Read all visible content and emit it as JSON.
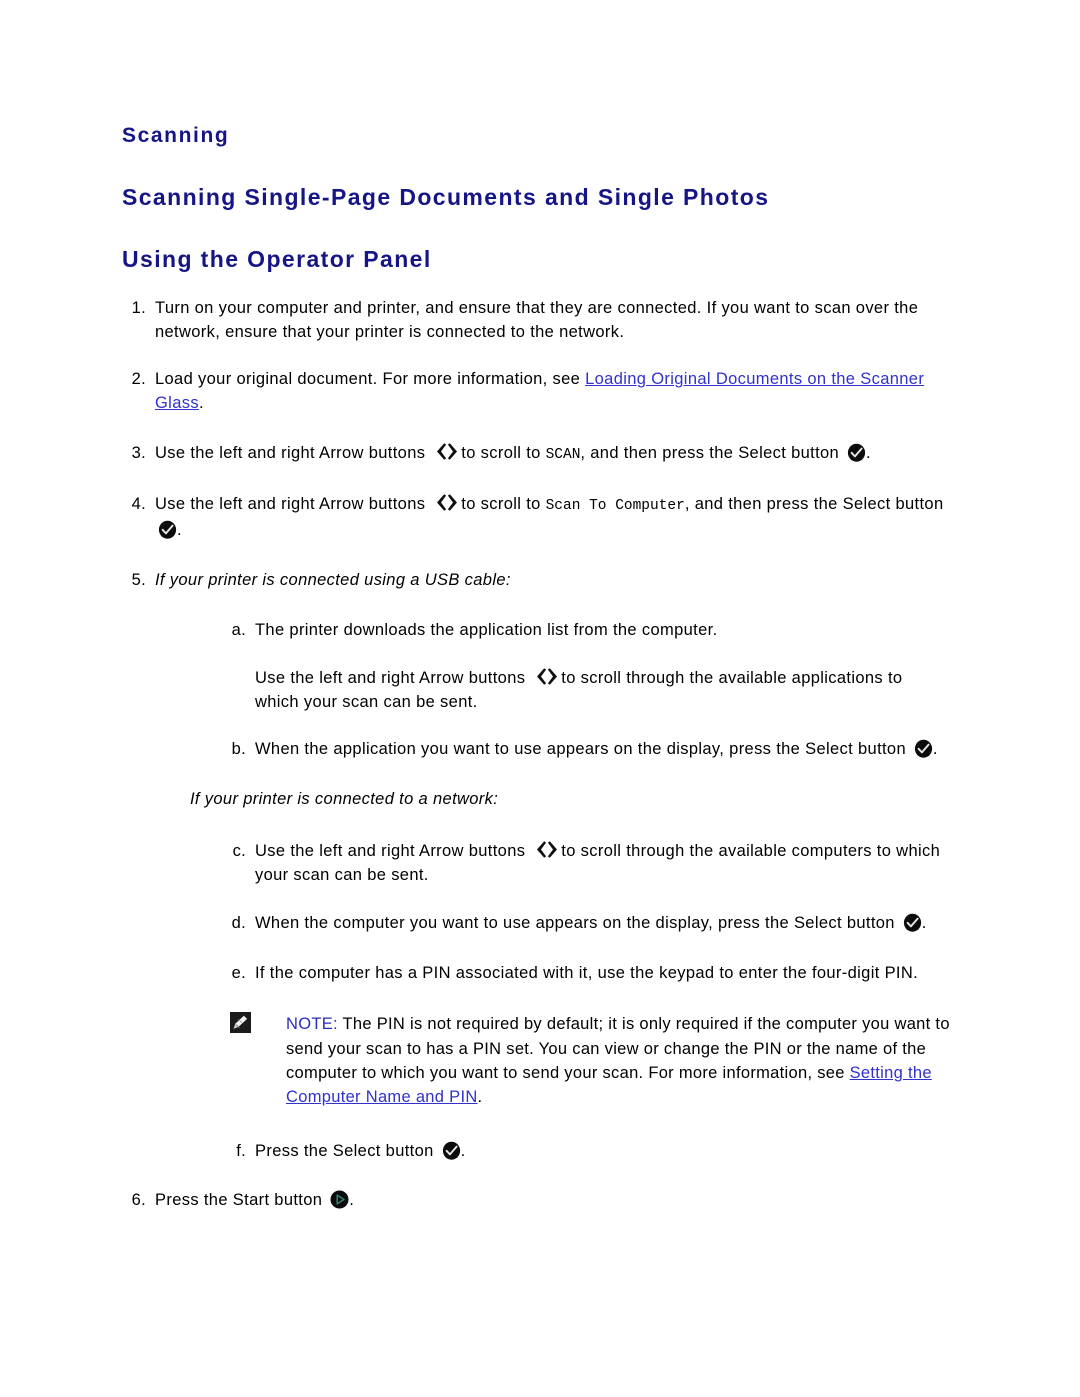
{
  "document": {
    "heading_main": "Scanning",
    "heading_sub": "Scanning Single-Page Documents and Single Photos",
    "heading_sub2": "Using the Operator Panel"
  },
  "colors": {
    "heading": "#151585",
    "link": "#3131cc",
    "note_label": "#2b2bbb",
    "body_text": "#000000",
    "page_background": "#ffffff",
    "start_icon_accent": "#2e7d6e"
  },
  "icons": {
    "arrows": "left-right-arrow-buttons-icon",
    "select": "select-button-check-icon",
    "start": "start-button-play-icon",
    "note": "note-pencil-icon"
  },
  "steps": {
    "s1": {
      "num": "1.",
      "text": "Turn on your computer and printer, and ensure that they are connected. If you want to scan over the network, ensure that your printer is connected to the network."
    },
    "s2": {
      "num": "2.",
      "text_before": "Load your original document. For more information, see ",
      "link": "Loading Original Documents on the Scanner Glass",
      "text_after": "."
    },
    "s3": {
      "num": "3.",
      "t1": "Use the left and right Arrow buttons ",
      "t2": "to scroll to ",
      "mono": "SCAN",
      "t3": ", and then press the Select button ",
      "t4": "."
    },
    "s4": {
      "num": "4.",
      "t1": "Use the left and right Arrow buttons ",
      "t2": "to scroll to ",
      "mono": "Scan To Computer",
      "t3": ", and then press the Select button ",
      "t4": "."
    },
    "s5": {
      "num": "5.",
      "text": "If your printer is connected using a USB cable:"
    },
    "s5a": {
      "num": "a.",
      "text": "The printer downloads the application list from the computer."
    },
    "s5a_cont": {
      "t1": "Use the left and right Arrow buttons ",
      "t2": "to scroll through the available applications to which your scan can be sent."
    },
    "s5b": {
      "num": "b.",
      "t1": "When the application you want to use appears on the display, press the Select button ",
      "t2": "."
    },
    "network_intro": {
      "text": "If your printer is connected to a network:"
    },
    "s5c": {
      "num": "c.",
      "t1": "Use the left and right Arrow buttons ",
      "t2": "to scroll through the available computers to which your scan can be sent."
    },
    "s5d": {
      "num": "d.",
      "t1": "When the computer you want to use appears on the display, press the Select button ",
      "t2": "."
    },
    "s5e": {
      "num": "e.",
      "text": "If the computer has a PIN associated with it, use the keypad to enter the four-digit PIN."
    },
    "note": {
      "label": "NOTE:",
      "text_before": " The PIN is not required by default; it is only required if the computer you want to send your scan to has a PIN set. You can view or change the PIN or the name of the computer to which you want to send your scan. For more information, see ",
      "link": "Setting the Computer Name and PIN",
      "text_after": "."
    },
    "s5f": {
      "num": "f.",
      "t1": "Press the Select button ",
      "t2": "."
    },
    "s6": {
      "num": "6.",
      "t1": "Press the Start button ",
      "t2": "."
    }
  }
}
